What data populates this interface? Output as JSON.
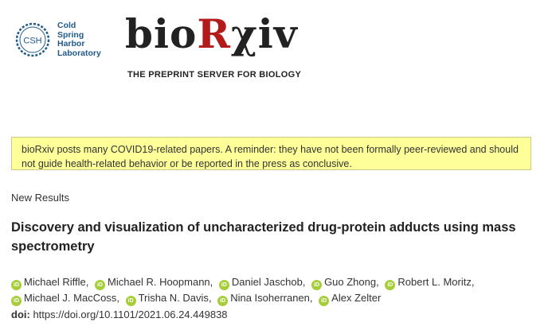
{
  "header": {
    "csh_logo": {
      "abbr": "CSH",
      "lines": [
        "Cold",
        "Spring",
        "Harbor",
        "Laboratory"
      ],
      "icon": "dna-helix-ring-icon",
      "color": "#1f5a8a"
    },
    "biorxiv_logo": {
      "part1": "bio",
      "part2": "R",
      "part3": "χiv",
      "accent_color": "#b31b1b"
    },
    "tagline": "THE PREPRINT SERVER FOR BIOLOGY"
  },
  "notice": {
    "text": "bioRxiv posts many COVID19-related papers. A reminder: they have not been formally peer-reviewed and should not guide health-related behavior or be reported in the press as conclusive.",
    "background": "#ffff99"
  },
  "article": {
    "section_label": "New Results",
    "title": "Discovery and visualization of uncharacterized drug-protein adducts using mass spectrometry",
    "authors_line1": [
      {
        "name": "Michael Riffle",
        "sep": ","
      },
      {
        "name": "Michael R. Hoopmann",
        "sep": ","
      },
      {
        "name": "Daniel Jaschob",
        "sep": ","
      },
      {
        "name": "Guo Zhong",
        "sep": ","
      },
      {
        "name": "Robert L. Moritz",
        "sep": ","
      }
    ],
    "authors_line2": [
      {
        "name": "Michael J. MacCoss",
        "sep": ","
      },
      {
        "name": "Trisha N. Davis",
        "sep": ","
      },
      {
        "name": "Nina Isoherranen",
        "sep": ","
      },
      {
        "name": "Alex Zelter",
        "sep": ""
      }
    ],
    "orcid_badge": "iD",
    "orcid_color": "#a6ce39",
    "doi_label": "doi:",
    "doi_value": "https://doi.org/10.1101/2021.06.24.449838"
  }
}
